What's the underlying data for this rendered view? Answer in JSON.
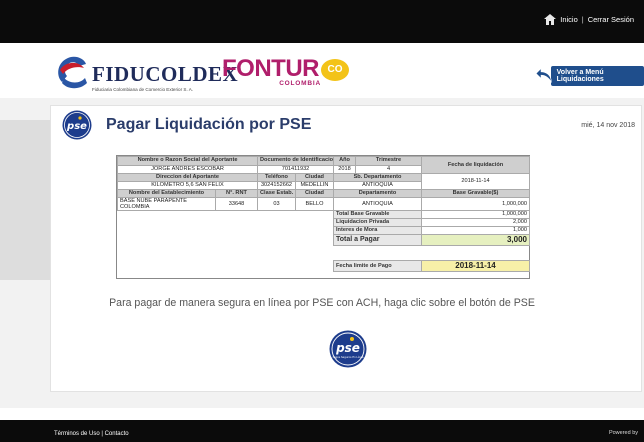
{
  "topbar": {
    "home_label": "Inicio",
    "separator": "|",
    "logout_label": "Cerrar Sesión"
  },
  "brand": {
    "fiduciaria_name": "FIDUCOLDEX",
    "fiduciaria_sub": "Fiduciaria Colombiana de Comercio Exterior S. A.",
    "fontur_name": "FONTUR",
    "fontur_badge": "CO",
    "fontur_country": "COLOMBIA"
  },
  "volver_label": "Volver a Menú Liquidaciones",
  "panel": {
    "title": "Pagar Liquidación por PSE",
    "date": "mié, 14 nov 2018"
  },
  "table": {
    "h_razon": "Nombre o Razon Social del Aportante",
    "h_documento": "Documento de Identificacion",
    "h_anio": "Año",
    "h_trimestre": "Trimestre",
    "h_fecha_liq": "Fecha de liquidación",
    "razon": "JORGE ANDRES ESCOBAR",
    "documento": "701411932",
    "anio": "2018",
    "trimestre": "4",
    "h_direccion": "Direccion del Aportante",
    "h_telefono": "Teléfono",
    "h_ciudad": "Ciudad",
    "h_sb_depto": "Sb. Departamento",
    "fecha_liq": "2018-11-14",
    "direccion": "KILOMETRO 5,6 SAN FELIX",
    "telefono": "3024152662",
    "ciudad": "MEDELLIN",
    "sb_depto": "ANTIOQUIA",
    "h_establecimiento": "Nombre del Establecimiento",
    "h_rnt": "N°. RNT",
    "h_clase": "Clase Estab.",
    "h_ciudad2": "Ciudad",
    "h_departamento": "Departamento",
    "h_base": "Base Gravable($)",
    "establecimiento": "BASE NUBE PARAPENTE COLOMBIA",
    "rnt": "33648",
    "clase": "03",
    "ciudad2": "BELLO",
    "departamento": "ANTIOQUIA",
    "base": "1,000,000",
    "total_base_label": "Total Base Gravable",
    "total_base": "1,000,000",
    "liq_privada_label": "Liquidacion Privada",
    "liq_privada": "2,000",
    "interes_label": "Interes de Mora",
    "interes": "1,000",
    "total_pagar_label": "Total a Pagar",
    "total_pagar": "3,000",
    "fecha_limite_label": "Fecha limite de Pago",
    "fecha_limite": "2018-11-14"
  },
  "notice": "Para pagar de manera segura en línea por PSE con ACH, haga clic sobre el botón de PSE",
  "pse": {
    "logo_text": "pse",
    "logo_sub": "Pagos Seguros En Línea"
  },
  "footer": {
    "terms": "Términos de Uso",
    "separator": "|",
    "contact": "Contacto",
    "powered": "Powered by"
  },
  "colors": {
    "topbar": "#0b0b0b",
    "title": "#2b3d6b",
    "fontur": "#b01e6b",
    "volver": "#1f4e8c",
    "total_bg": "#e6f0c0",
    "limit_bg": "#f7f0a8"
  }
}
